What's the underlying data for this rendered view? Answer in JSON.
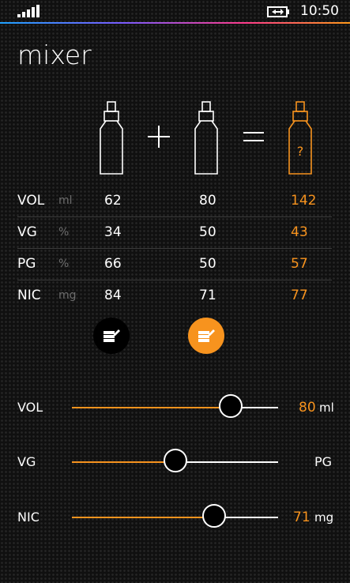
{
  "status": {
    "time": "10:50",
    "signal_icon": "signal-bars-icon",
    "battery_icon": "battery-charging-icon"
  },
  "app": {
    "title": "mixer"
  },
  "table": {
    "rows": [
      {
        "label": "VOL",
        "unit": "ml",
        "a": "62",
        "b": "80",
        "result": "142"
      },
      {
        "label": "VG",
        "unit": "%",
        "a": "34",
        "b": "50",
        "result": "43"
      },
      {
        "label": "PG",
        "unit": "%",
        "a": "66",
        "b": "50",
        "result": "57"
      },
      {
        "label": "NIC",
        "unit": "mg",
        "a": "84",
        "b": "71",
        "result": "77"
      }
    ]
  },
  "sliders": {
    "vol": {
      "label": "VOL",
      "value": "80",
      "unit": "ml",
      "position": 0.77
    },
    "ratio": {
      "left_label": "VG",
      "right_label": "PG",
      "position": 0.5
    },
    "nic": {
      "label": "NIC",
      "value": "71",
      "unit": "mg",
      "position": 0.69
    }
  },
  "colors": {
    "accent": "#f7931e",
    "text": "#ffffff",
    "muted": "#6d6d6d",
    "divider": "#3a3a3a"
  }
}
